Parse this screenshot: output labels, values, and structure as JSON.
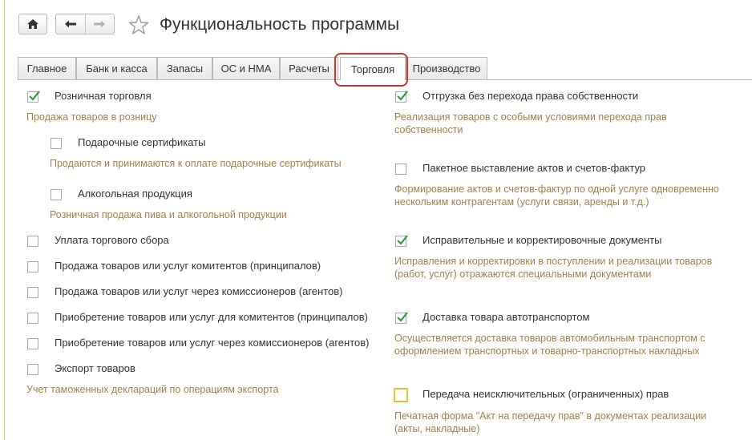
{
  "window": {
    "title": "Функциональность программы"
  },
  "header": {
    "home_icon": "home-icon",
    "back_icon": "arrow-left-icon",
    "forward_icon": "arrow-right-icon",
    "favorite_icon": "star-icon"
  },
  "tabs": [
    {
      "label": "Главное"
    },
    {
      "label": "Банк и касса"
    },
    {
      "label": "Запасы"
    },
    {
      "label": "ОС и НМА"
    },
    {
      "label": "Расчеты"
    },
    {
      "label": "Торговля",
      "active": true
    },
    {
      "label": "Производство"
    }
  ],
  "colors": {
    "accent_highlight": "#c0392b",
    "check": "#2e9e3a",
    "description": "#a0814a",
    "focus": "#e6c13a"
  },
  "left_column": {
    "retail": {
      "label": "Розничная торговля",
      "checked": true,
      "desc": "Продажа товаров в розницу"
    },
    "gift_cards": {
      "label": "Подарочные сертификаты",
      "checked": false,
      "desc": "Продаются и принимаются к оплате подарочные сертификаты"
    },
    "alcohol": {
      "label": "Алкогольная продукция",
      "checked": false,
      "desc": "Розничная продажа пива и алкогольной продукции"
    },
    "trade_fee": {
      "label": "Уплата торгового сбора",
      "checked": false
    },
    "principal_sale": {
      "label": "Продажа товаров или услуг комитентов (принципалов)",
      "checked": false
    },
    "agent_sale": {
      "label": "Продажа товаров или услуг через комиссионеров (агентов)",
      "checked": false
    },
    "principal_purchase": {
      "label": "Приобретение товаров или услуг для комитентов (принципалов)",
      "checked": false
    },
    "agent_purchase": {
      "label": "Приобретение товаров или услуг через комиссионеров (агентов)",
      "checked": false
    },
    "export": {
      "label": "Экспорт товаров",
      "checked": false,
      "desc": "Учет таможенных деклараций по операциям экспорта"
    }
  },
  "right_column": {
    "shipment": {
      "label": "Отгрузка без перехода права собственности",
      "checked": true,
      "desc": "Реализация товаров с особыми условиями перехода прав собственности"
    },
    "batch_invoices": {
      "label": "Пакетное выставление актов и счетов-фактур",
      "checked": false,
      "desc": "Формирование актов и счетов-фактур по одной услуге одновременно нескольким контрагентам (услуги связи, аренды и т.д.)"
    },
    "corrections": {
      "label": "Исправительные и корректировочные документы",
      "checked": true,
      "desc": "Исправления и корректировки в поступлении и реализации товаров (работ, услуг) отражаются специальными документами"
    },
    "delivery": {
      "label": "Доставка товара автотранспортом",
      "checked": true,
      "desc": "Осуществляется доставка товаров автомобильным транспортом с оформлением транспортных и товарно-транспортных накладных"
    },
    "rights_transfer": {
      "label": "Передача неисключительных (ограниченных) прав",
      "checked": false,
      "focused": true,
      "desc": "Печатная форма \"Акт на передачу прав\" в документах реализации (акты, накладные)"
    }
  }
}
